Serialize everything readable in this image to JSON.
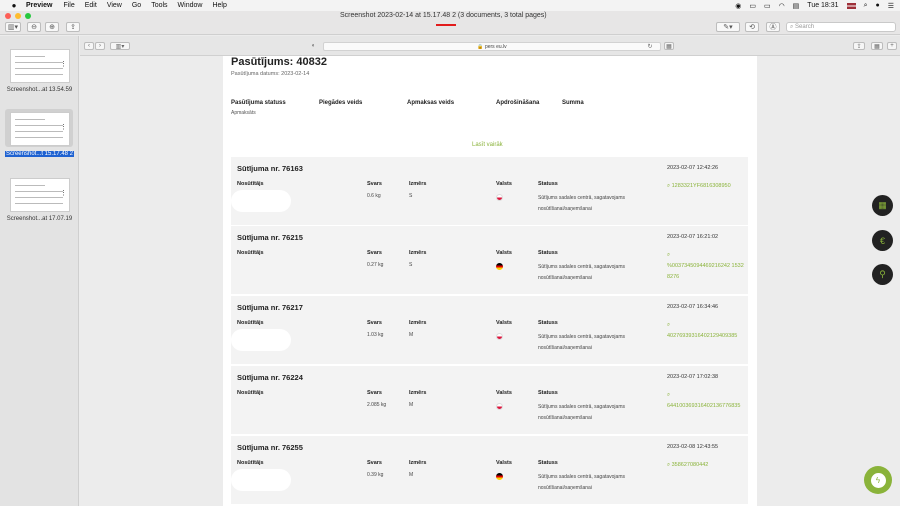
{
  "menubar": {
    "apple": "",
    "app": "Preview",
    "items": [
      "File",
      "Edit",
      "View",
      "Go",
      "Tools",
      "Window",
      "Help"
    ],
    "clock": "Tue 18:31"
  },
  "window": {
    "title": "Screenshot 2023-02-14 at 15.17.48 2 (3 documents, 3 total pages)",
    "search_placeholder": "Search"
  },
  "thumbnails": [
    {
      "label": "Screenshot...at 13.54.59"
    },
    {
      "label": "Screenshot...t 15.17.48 2"
    },
    {
      "label": "Screenshot...at 17.07.19"
    }
  ],
  "browser": {
    "url": "🔒 pers eu.lv"
  },
  "order": {
    "title": "Pasūtījums: 40832",
    "date": "Pasūtījuma datums: 2023-02-14",
    "headers": [
      "Pasūtījuma statuss",
      "Piegādes veids",
      "Apmaksas veids",
      "Apdrošināšana",
      "Summa"
    ],
    "status_value": "Apmaksāts",
    "more_link": "Lasīt vairāk"
  },
  "labels": {
    "sender": "Nosūtītājs",
    "weight": "Svars",
    "size": "Izmērs",
    "country": "Valsts",
    "status": "Statuss",
    "status_text": "Sūtījums sadales centrā, sagatavojams nosūtīšanai/saņemšanai"
  },
  "shipments": [
    {
      "title": "Sūtījuma nr. 76163",
      "weight": "0.6 kg",
      "size": "S",
      "flag": "pl",
      "timestamp": "2023-02-07 12:42:26",
      "tracking": "1283321YF6816308950"
    },
    {
      "title": "Sūtījuma nr. 76215",
      "weight": "0.27 kg",
      "size": "S",
      "flag": "de",
      "timestamp": "2023-02-07 16:21:02",
      "tracking": "%0037345094469216242 15328276"
    },
    {
      "title": "Sūtījuma nr. 76217",
      "weight": "1.03 kg",
      "size": "M",
      "flag": "pl",
      "timestamp": "2023-02-07 16:34:46",
      "tracking": "40276939316402129409385"
    },
    {
      "title": "Sūtījuma nr. 76224",
      "weight": "2.085 kg",
      "size": "M",
      "flag": "pl",
      "timestamp": "2023-02-07 17:02:38",
      "tracking": "644100369316402136776835"
    },
    {
      "title": "Sūtījuma nr. 76255",
      "weight": "0.39 kg",
      "size": "M",
      "flag": "de",
      "timestamp": "2023-02-08 12:43:55",
      "tracking": "358627080442"
    }
  ],
  "colors": {
    "accent": "#8ab33a",
    "selection": "#1f62d1"
  }
}
